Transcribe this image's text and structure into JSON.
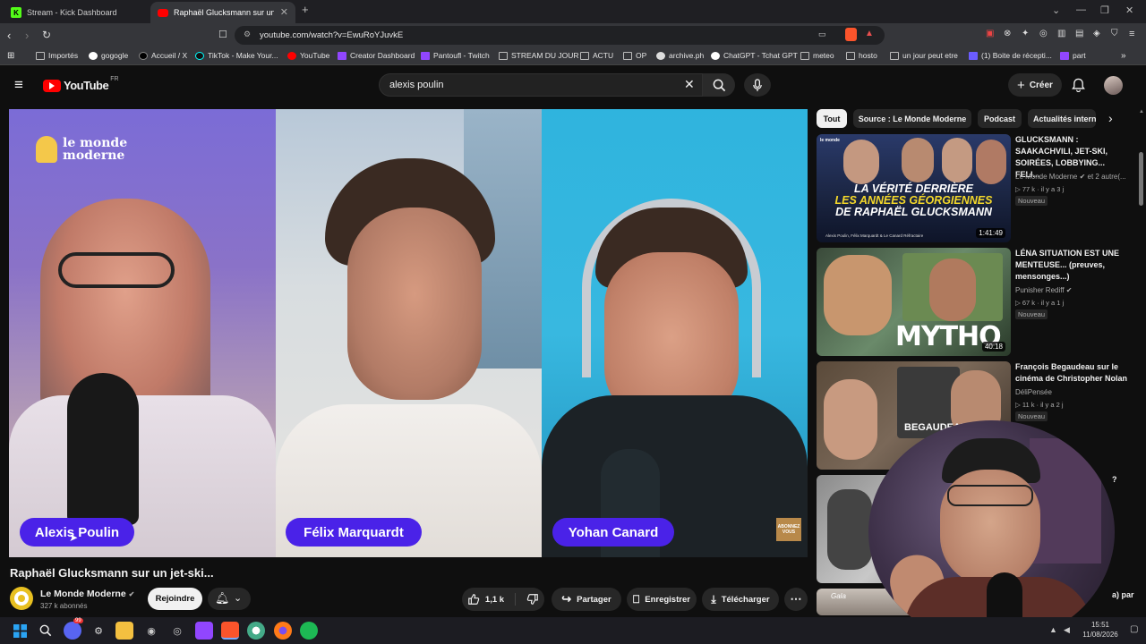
{
  "browser": {
    "tabs": [
      {
        "label": "Stream - Kick Dashboard",
        "active": false
      },
      {
        "label": "Raphaël Glucksmann sur un jet-ski",
        "active": true
      }
    ],
    "url": "youtube.com/watch?v=EwuRoYJuvkE",
    "bookmarks": [
      "Importés",
      "gogogle",
      "Accueil / X",
      "TikTok - Make Your...",
      "YouTube",
      "Creator Dashboard",
      "Pantoufl - Twitch",
      "STREAM DU JOUR",
      "ACTU",
      "OP",
      "archive.ph",
      "ChatGPT - Tchat GPT",
      "meteo",
      "hosto",
      "un jour peut etre",
      "(1) Boite de récepti...",
      "part"
    ]
  },
  "youtube": {
    "logo": "YouTube",
    "region": "FR",
    "search_query": "alexis poulin",
    "create_label": "Créer"
  },
  "video": {
    "overlay_logo": [
      "le monde",
      "moderne"
    ],
    "speakers": [
      "Alexis Poulin",
      "Félix Marquardt",
      "Yohan Canard"
    ],
    "corner_badge": [
      "ABONNEZ",
      "VOUS"
    ],
    "title": "Raphaël Glucksmann sur un jet-ski...",
    "channel": "Le Monde Moderne",
    "subscribers": "327 k abonnés",
    "join_label": "Rejoindre",
    "likes": "1,1 k",
    "share_label": "Partager",
    "save_label": "Enregistrer",
    "download_label": "Télécharger"
  },
  "sidebar": {
    "chips": [
      "Tout",
      "Source : Le Monde Moderne",
      "Podcast",
      "Actualités intern"
    ],
    "recommendations": [
      {
        "title": "GLUCKSMANN : SAAKACHVILI, JET-SKI, SOIRÉES, LOBBYING... FELI...",
        "channel": "Le Monde Moderne ✔ et 2 autre(...",
        "meta": "▷ 77 k · il y a 3 j",
        "badge": "Nouveau",
        "duration": "1:41:49",
        "thumb_text": [
          "LA VÉRITÉ DERRIÈRE",
          "LES ANNÉES GÉORGIENNES",
          "DE RAPHAËL GLUCKSMANN"
        ],
        "thumb_sub": "Alexis Poulin, Félix Marquardt & Le Canard Réfractaire"
      },
      {
        "title": "LÉNA SITUATION EST UNE MENTEUSE... (preuves, mensonges...)",
        "channel": "Punisher Rediff ✔",
        "meta": "▷ 67 k · il y a 1 j",
        "badge": "Nouveau",
        "duration": "40:18",
        "thumb_text": [
          "MYTHO"
        ]
      },
      {
        "title": "François Begaudeau sur le cinéma de Christopher Nolan",
        "channel": "DéliPensée",
        "meta": "▷ 11 k · il y a 2 j",
        "badge": "Nouveau",
        "thumb_text": [
          "BEGAUDEAU"
        ]
      },
      {
        "title": "?",
        "partial": true
      },
      {
        "title": "a) par",
        "partial": true,
        "thumb_text": [
          "Gala"
        ]
      }
    ]
  },
  "taskbar": {
    "time": "15:51",
    "date": "11/08/2026",
    "notification_count": "99"
  }
}
